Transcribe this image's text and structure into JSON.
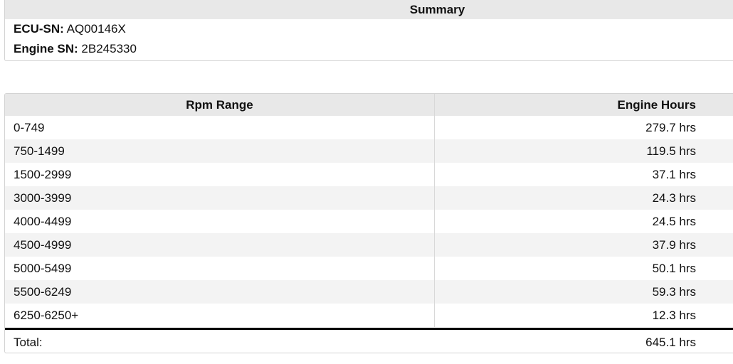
{
  "summary": {
    "title": "Summary",
    "ecu_sn_label": "ECU-SN:",
    "ecu_sn_value": "AQ00146X",
    "engine_sn_label": "Engine SN:",
    "engine_sn_value": "2B245330"
  },
  "table": {
    "headers": {
      "rpm_range": "Rpm Range",
      "engine_hours": "Engine Hours"
    },
    "rows": [
      {
        "rpm": "0-749",
        "hours": "279.7 hrs"
      },
      {
        "rpm": "750-1499",
        "hours": "119.5 hrs"
      },
      {
        "rpm": "1500-2999",
        "hours": "37.1 hrs"
      },
      {
        "rpm": "3000-3999",
        "hours": "24.3 hrs"
      },
      {
        "rpm": "4000-4499",
        "hours": "24.5 hrs"
      },
      {
        "rpm": "4500-4999",
        "hours": "37.9 hrs"
      },
      {
        "rpm": "5000-5499",
        "hours": "50.1 hrs"
      },
      {
        "rpm": "5500-6249",
        "hours": "59.3 hrs"
      },
      {
        "rpm": "6250-6250+",
        "hours": "12.3 hrs"
      }
    ],
    "total": {
      "label": "Total:",
      "hours": "645.1 hrs"
    }
  }
}
